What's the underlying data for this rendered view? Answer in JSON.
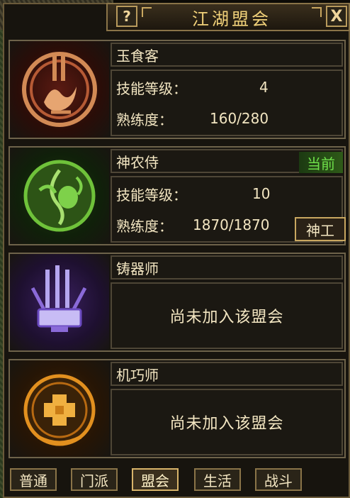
{
  "window": {
    "title": "江湖盟会",
    "help_label": "?",
    "close_label": "X"
  },
  "guilds": [
    {
      "name": "玉食客",
      "level_label": "技能等级：",
      "level_value": "4",
      "proficiency_label": "熟练度：",
      "proficiency_value": "160/280",
      "emblem": "chef-emblem-icon",
      "color": "#c53b2a"
    },
    {
      "name": "神农侍",
      "status_badge": "当前",
      "level_label": "技能等级：",
      "level_value": "10",
      "proficiency_label": "熟练度：",
      "proficiency_value": "1870/1870",
      "action_button": "神工",
      "emblem": "herbalist-emblem-icon",
      "color": "#5bbb2c"
    },
    {
      "name": "铸器师",
      "not_joined": "尚未加入该盟会",
      "emblem": "blacksmith-emblem-icon",
      "color": "#8a6ad8"
    },
    {
      "name": "机巧师",
      "not_joined": "尚未加入该盟会",
      "emblem": "engineer-emblem-icon",
      "color": "#e2901f"
    }
  ],
  "tabs": [
    "普通",
    "门派",
    "盟会",
    "生活",
    "战斗"
  ],
  "active_tab": "盟会"
}
